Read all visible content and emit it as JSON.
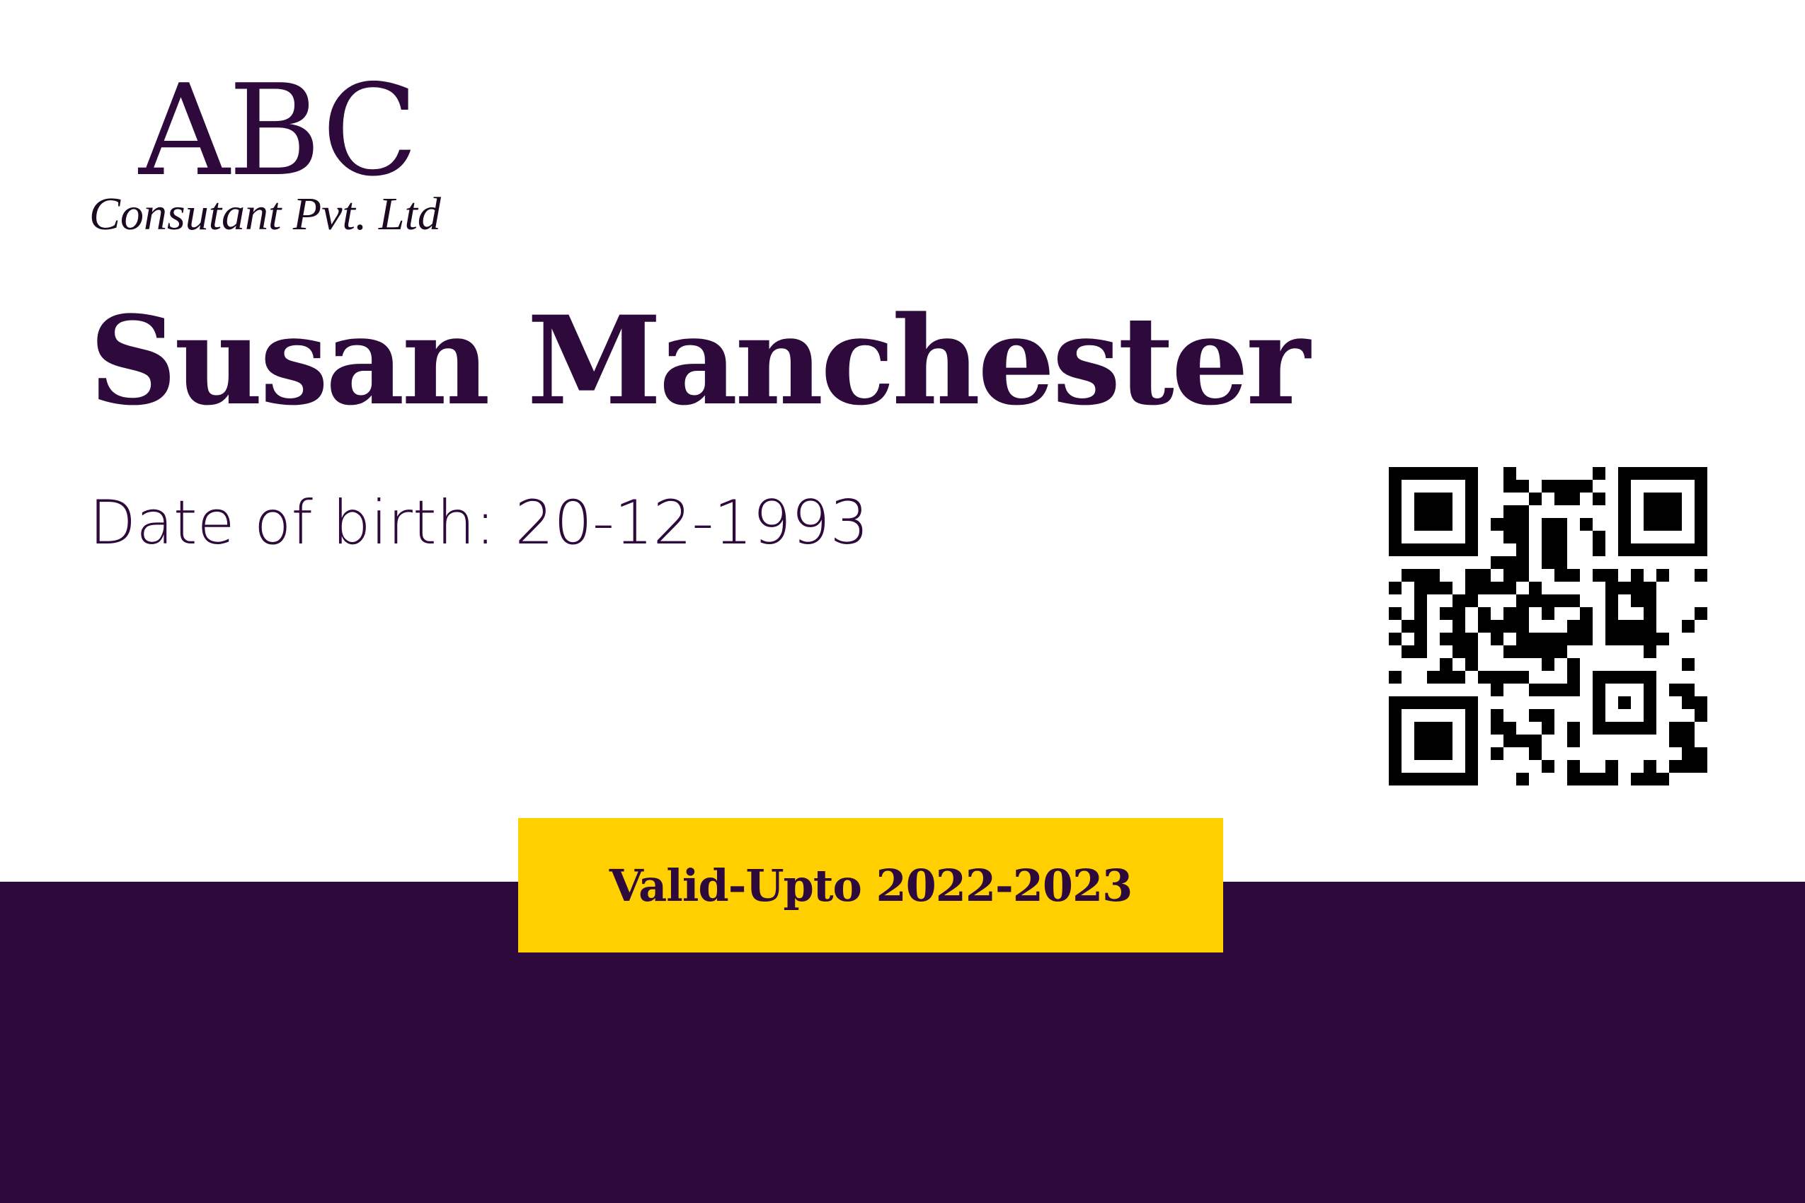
{
  "company": {
    "name": "ABC",
    "subtitle": "Consutant Pvt. Ltd"
  },
  "holder": {
    "name": "Susan Manchester",
    "dob_text": "Date of birth: 20-12-1993"
  },
  "validity": {
    "text": "Valid-Upto 2022-2023"
  },
  "colors": {
    "primary": "#2e0a3c",
    "accent": "#ffcf00",
    "background": "#ffffff"
  },
  "qr_code": {
    "icon": "qr-code-icon"
  }
}
